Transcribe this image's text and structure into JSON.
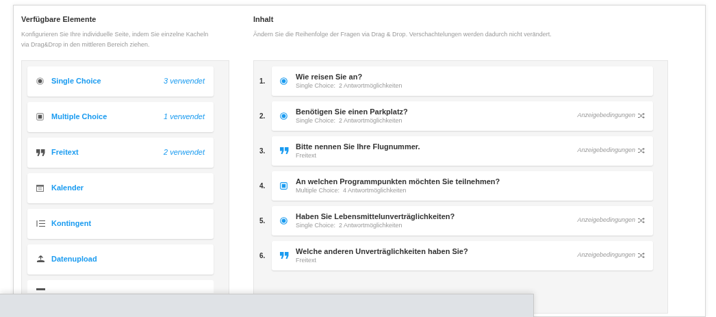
{
  "available": {
    "title": "Verfügbare Elemente",
    "description": "Konfigurieren Sie Ihre individuelle Seite, indem Sie einzelne Kacheln via Drag&Drop in den mittleren Bereich ziehen.",
    "tiles": [
      {
        "kind": "single",
        "label": "Single Choice",
        "usage": "3 verwendet"
      },
      {
        "kind": "multiple",
        "label": "Multiple Choice",
        "usage": "1 verwendet"
      },
      {
        "kind": "text",
        "label": "Freitext",
        "usage": "2 verwendet"
      },
      {
        "kind": "calendar",
        "label": "Kalender"
      },
      {
        "kind": "quota",
        "label": "Kontingent"
      },
      {
        "kind": "upload",
        "label": "Datenupload"
      },
      {
        "kind": "block"
      }
    ]
  },
  "content": {
    "title": "Inhalt",
    "description": "Ändern Sie die Reihenfolge der Fragen via Drag & Drop. Verschachtelungen werden dadurch nicht verändert.",
    "questions": [
      {
        "number": "1.",
        "kind": "single",
        "title": "Wie reisen Sie an?",
        "type": "Single Choice:",
        "options": "2 Antwortmöglichkeiten"
      },
      {
        "number": "2.",
        "kind": "single",
        "title": "Benötigen Sie einen Parkplatz?",
        "type": "Single Choice:",
        "options": "2 Antwortmöglichkeiten",
        "conditions": "Anzeigebedingungen"
      },
      {
        "number": "3.",
        "kind": "text",
        "title": "Bitte nennen Sie Ihre Flugnummer.",
        "type": "Freitext",
        "conditions": "Anzeigebedingungen"
      },
      {
        "number": "4.",
        "kind": "multiple",
        "title": "An welchen Programmpunkten möchten Sie teilnehmen?",
        "type": "Multiple Choice:",
        "options": "4 Antwortmöglichkeiten"
      },
      {
        "number": "5.",
        "kind": "single",
        "title": "Haben Sie Lebensmittelunverträglichkeiten?",
        "type": "Single Choice:",
        "options": "2 Antwortmöglichkeiten",
        "conditions": "Anzeigebedingungen"
      },
      {
        "number": "6.",
        "kind": "text",
        "title": "Welche anderen Unverträglichkeiten haben Sie?",
        "type": "Freitext",
        "conditions": "Anzeigebedingungen"
      }
    ]
  }
}
